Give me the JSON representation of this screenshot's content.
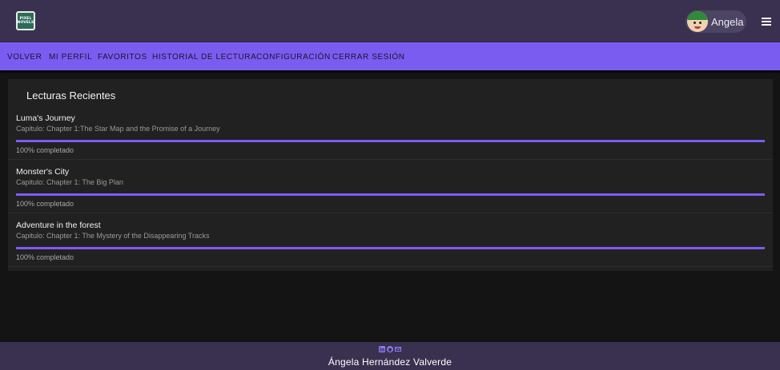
{
  "header": {
    "logo_line1": "PIXEL",
    "logo_line2": "NOVELS",
    "user_name": "Angela"
  },
  "nav": [
    {
      "label": "VOLVER"
    },
    {
      "label": "MI PERFIL"
    },
    {
      "label": "FAVORITOS"
    },
    {
      "label": "HISTORIAL DE LECTURA"
    },
    {
      "label": "CONFIGURACIÓN"
    },
    {
      "label": "CERRAR SESIÓN"
    }
  ],
  "recent": {
    "title": "Lecturas Recientes",
    "items": [
      {
        "title": "Luma's Journey",
        "chapter": "Capitulo: Chapter 1:The Star Map and the Promise of a Journey",
        "progress_text": "100% completado",
        "progress": 1.0
      },
      {
        "title": "Monster's City",
        "chapter": "Capitulo: Chapter 1: The Big Plan",
        "progress_text": "100% completado",
        "progress": 1.0
      },
      {
        "title": "Adventure in the forest",
        "chapter": "Capitulo: Chapter 1: The Mystery of the Disappearing Tracks",
        "progress_text": "100% completado",
        "progress": 1.0
      }
    ]
  },
  "footer": {
    "icons": [
      "linkedin-icon",
      "github-icon",
      "mail-icon"
    ],
    "name": "Ángela Hernández Valverde"
  },
  "colors": {
    "header_bg": "#3a3150",
    "accent": "#7b5cf0",
    "page_bg": "#141414",
    "card_bg": "#212121"
  }
}
